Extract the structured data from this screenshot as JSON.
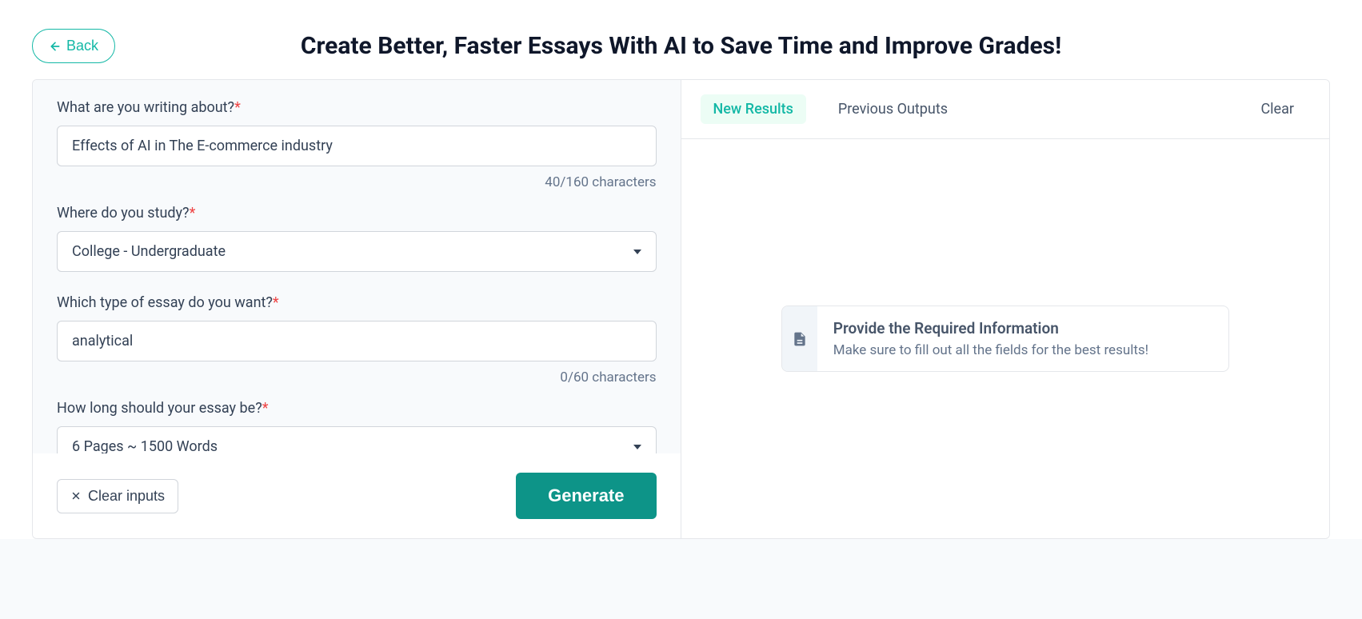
{
  "header": {
    "back_label": "Back",
    "title": "Create Better, Faster Essays With AI to Save Time and Improve Grades!"
  },
  "form": {
    "topic": {
      "label": "What are you writing about?",
      "value": "Effects of AI in The E-commerce industry",
      "counter": "40/160 characters"
    },
    "study": {
      "label": "Where do you study?",
      "selected": "College - Undergraduate"
    },
    "essay_type": {
      "label": "Which type of essay do you want?",
      "value": "analytical",
      "counter": "0/60 characters"
    },
    "length": {
      "label": "How long should your essay be?",
      "selected": "6 Pages ~ 1500 Words"
    }
  },
  "actions": {
    "clear_inputs": "Clear inputs",
    "generate": "Generate"
  },
  "results": {
    "tab_new": "New Results",
    "tab_previous": "Previous Outputs",
    "clear": "Clear",
    "info_title": "Provide the Required Information",
    "info_sub": "Make sure to fill out all the fields for the best results!"
  }
}
